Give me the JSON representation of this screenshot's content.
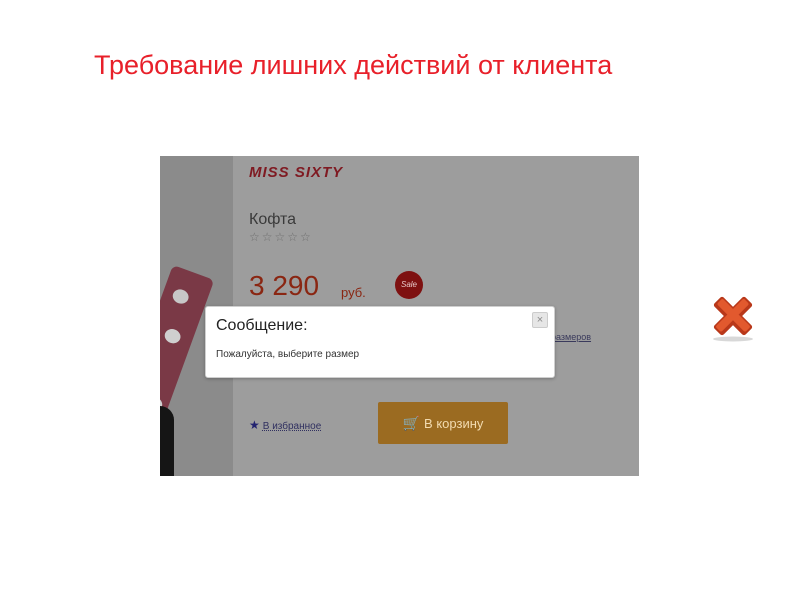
{
  "slide": {
    "title": "Требование лишних действий от клиента",
    "title_color": "#e8202a",
    "mark_icon": "red-x-icon",
    "mark_color": "#d6451c"
  },
  "store": {
    "brand": "MISS SIXTY",
    "product_name": "Кофта",
    "rating_stars": "☆☆☆☆☆",
    "price": "3 290",
    "currency": "руб.",
    "sale_badge": "Sale",
    "size_link": "размеров",
    "favorites_icon": "star-icon",
    "favorites_label": "В избранное",
    "cart_icon": "cart-icon",
    "cart_button": "В корзину"
  },
  "modal": {
    "title": "Сообщение:",
    "message": "Пожалуйста, выберите размер",
    "close_glyph": "×"
  }
}
